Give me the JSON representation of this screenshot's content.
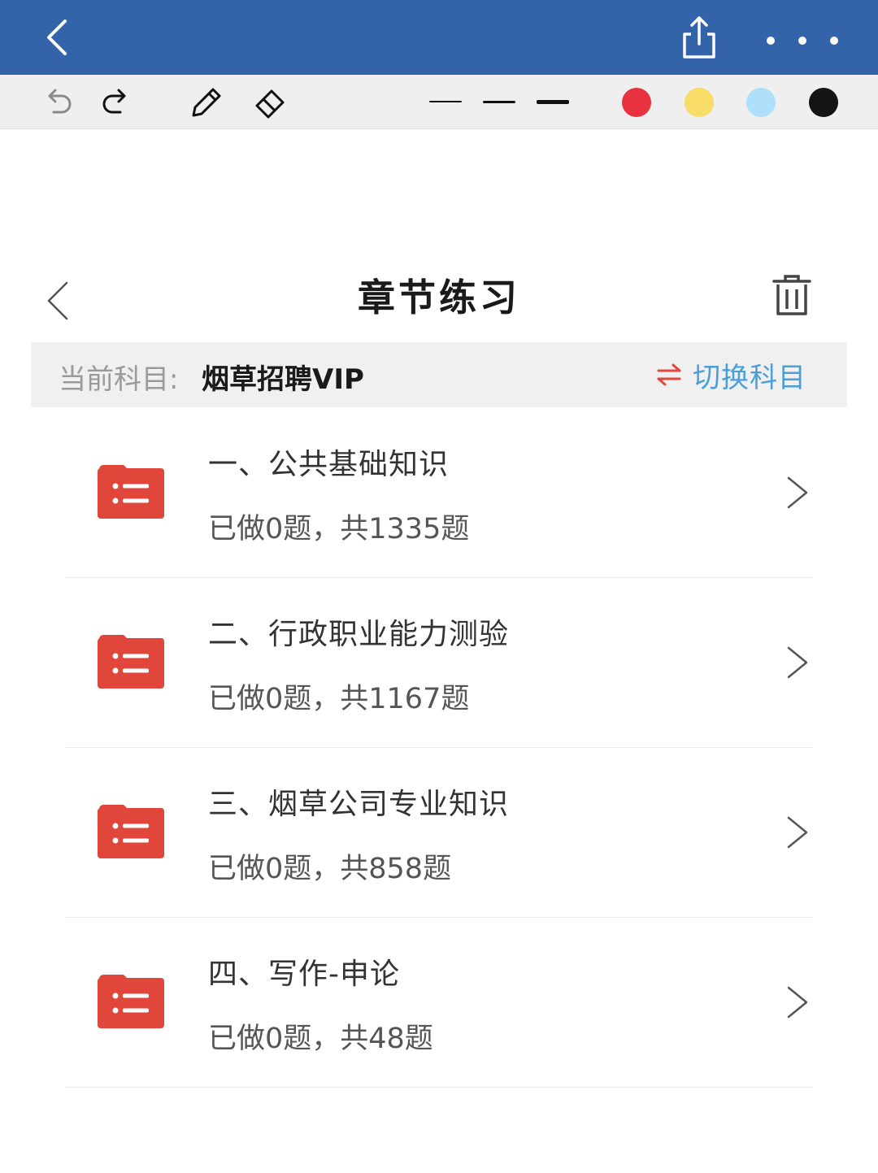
{
  "colors": {
    "topbar": "#3363a8",
    "accent_blue": "#4a9fd8",
    "accent_red": "#e2483d",
    "folder_red": "#e0463a",
    "swatch_red": "#e8323f",
    "swatch_yellow": "#f8dc68",
    "swatch_lightblue": "#aee0fb",
    "swatch_black": "#141414"
  },
  "topbar": {
    "icons": [
      "back-arrow-icon",
      "share-icon",
      "more-dots-icon"
    ]
  },
  "toolbar": {
    "tools": [
      "undo-icon",
      "redo-icon",
      "pencil-icon",
      "eraser-icon"
    ],
    "stroke_widths": [
      "thin",
      "medium",
      "thick"
    ],
    "swatches": [
      "red",
      "yellow",
      "light-blue",
      "black"
    ]
  },
  "page": {
    "title": "章节练习"
  },
  "subject": {
    "label": "当前科目:",
    "value": "烟草招聘VIP",
    "switch_label": "切换科目"
  },
  "chapters": [
    {
      "title": "一、公共基础知识",
      "progress": "已做0题，共1335题"
    },
    {
      "title": "二、行政职业能力测验",
      "progress": "已做0题，共1167题"
    },
    {
      "title": "三、烟草公司专业知识",
      "progress": "已做0题，共858题"
    },
    {
      "title": "四、写作-申论",
      "progress": "已做0题，共48题"
    }
  ]
}
